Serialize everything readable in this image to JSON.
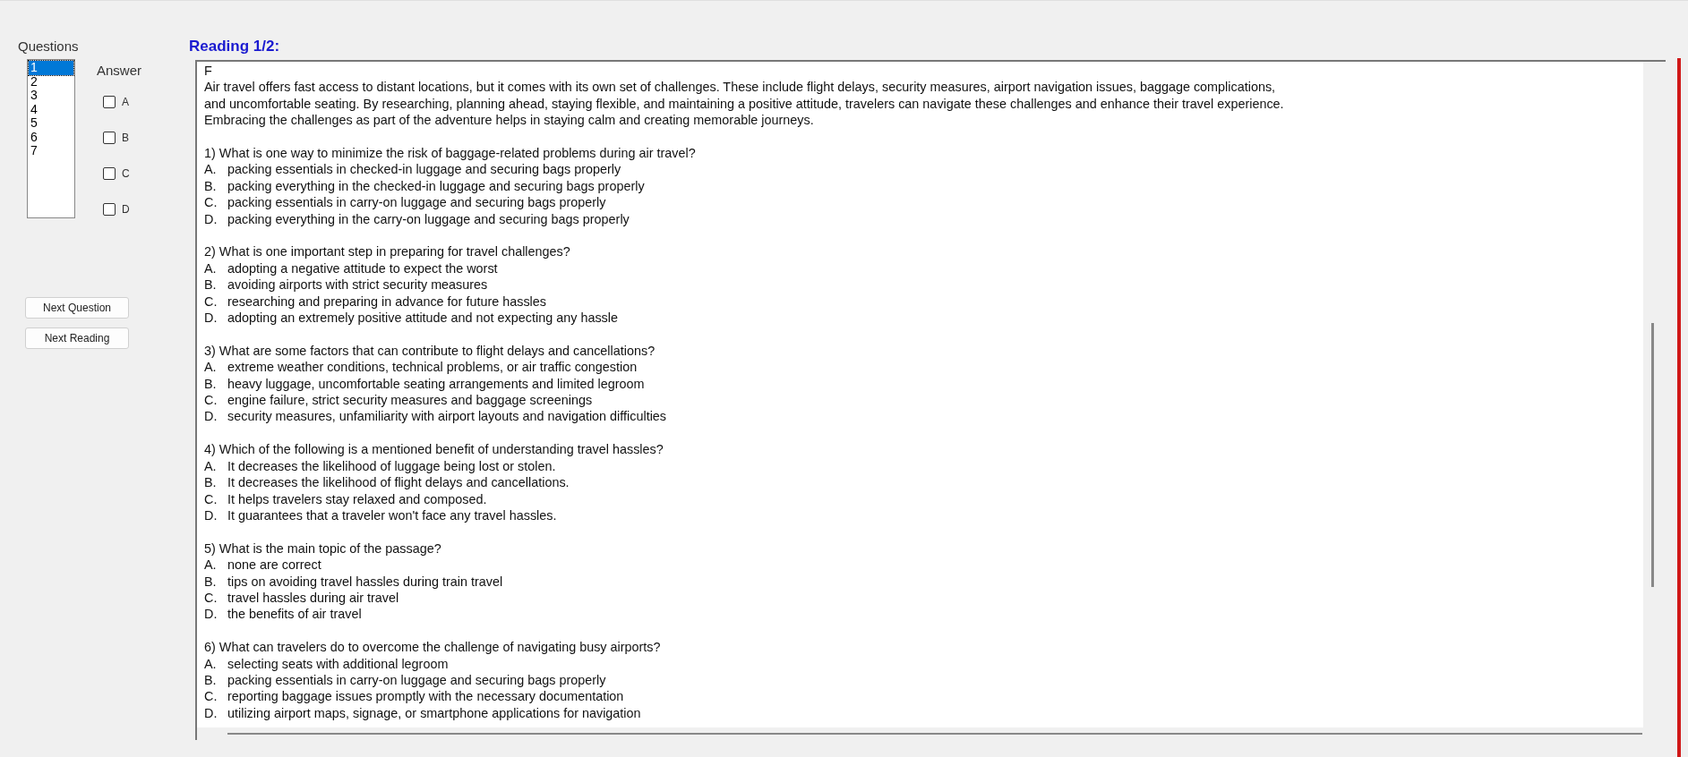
{
  "questions_panel": {
    "label": "Questions",
    "items": [
      {
        "label": "1",
        "selected": true
      },
      {
        "label": "2",
        "selected": false
      },
      {
        "label": "3",
        "selected": false
      },
      {
        "label": "4",
        "selected": false
      },
      {
        "label": "5",
        "selected": false
      },
      {
        "label": "6",
        "selected": false
      },
      {
        "label": "7",
        "selected": false
      }
    ]
  },
  "answer": {
    "label": "Answer",
    "options": [
      {
        "label": "A",
        "checked": false
      },
      {
        "label": "B",
        "checked": false
      },
      {
        "label": "C",
        "checked": false
      },
      {
        "label": "D",
        "checked": false
      }
    ]
  },
  "buttons": [
    "Next Question",
    "Next Reading"
  ],
  "reading": {
    "title": "Reading 1/2:",
    "header": "F",
    "passage": [
      "Air travel offers fast access to distant locations, but it comes with its own set of challenges. These include flight delays, security measures, airport navigation issues, baggage complications,",
      "and uncomfortable seating. By researching, planning ahead, staying flexible, and maintaining a positive attitude, travelers can navigate these challenges and enhance their travel experience.",
      "Embracing the challenges as part of the adventure helps in staying calm and creating memorable journeys."
    ],
    "questions": [
      {
        "text": "1) What is one way to minimize the risk of baggage-related problems during air travel?",
        "options": [
          {
            "letter": "A.",
            "text": "packing essentials in checked-in luggage and securing bags properly"
          },
          {
            "letter": "B.",
            "text": "packing everything in the checked-in luggage and securing bags properly"
          },
          {
            "letter": "C.",
            "text": "packing essentials in carry-on luggage and securing bags properly"
          },
          {
            "letter": "D.",
            "text": "packing everything in the carry-on luggage and securing bags properly"
          }
        ]
      },
      {
        "text": "2) What is one important step in preparing for travel challenges?",
        "options": [
          {
            "letter": "A.",
            "text": "adopting a negative attitude to expect the worst"
          },
          {
            "letter": "B.",
            "text": "avoiding airports with strict security measures"
          },
          {
            "letter": "C.",
            "text": "researching and preparing in advance for future hassles"
          },
          {
            "letter": "D.",
            "text": "adopting an extremely positive attitude and not expecting any hassle"
          }
        ]
      },
      {
        "text": "3) What are some factors that can contribute to flight delays and cancellations?",
        "options": [
          {
            "letter": "A.",
            "text": "extreme weather conditions, technical problems, or air traffic congestion"
          },
          {
            "letter": "B.",
            "text": "heavy luggage, uncomfortable seating arrangements and limited legroom"
          },
          {
            "letter": "C.",
            "text": "engine failure, strict security measures and baggage screenings"
          },
          {
            "letter": "D.",
            "text": "security measures, unfamiliarity with airport layouts and navigation difficulties"
          }
        ]
      },
      {
        "text": "4) Which of the following is a mentioned benefit of understanding travel hassles?",
        "options": [
          {
            "letter": "A.",
            "text": "It decreases the likelihood of luggage being lost or stolen."
          },
          {
            "letter": "B.",
            "text": "It decreases the likelihood of flight delays and cancellations."
          },
          {
            "letter": "C.",
            "text": "It helps travelers stay relaxed and composed."
          },
          {
            "letter": "D.",
            "text": "It guarantees that a traveler won't face any travel hassles."
          }
        ]
      },
      {
        "text": "5) What is the main topic of the passage?",
        "options": [
          {
            "letter": "A.",
            "text": "none are correct"
          },
          {
            "letter": "B.",
            "text": "tips on avoiding travel hassles during train travel"
          },
          {
            "letter": "C.",
            "text": "travel hassles during air travel"
          },
          {
            "letter": "D.",
            "text": "the benefits of air travel"
          }
        ]
      },
      {
        "text": "6) What can travelers do to overcome the challenge of navigating busy airports?",
        "options": [
          {
            "letter": "A.",
            "text": "selecting seats with additional legroom"
          },
          {
            "letter": "B.",
            "text": "packing essentials in carry-on luggage and securing bags properly"
          },
          {
            "letter": "C.",
            "text": "reporting baggage issues promptly with the necessary documentation"
          },
          {
            "letter": "D.",
            "text": "utilizing airport maps, signage, or smartphone applications for navigation"
          }
        ]
      }
    ]
  }
}
